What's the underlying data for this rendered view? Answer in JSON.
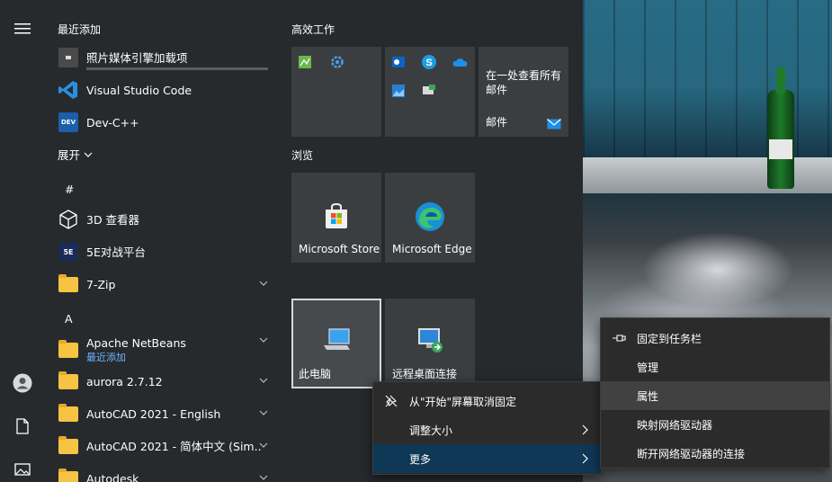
{
  "applist": {
    "recent_header": "最近添加",
    "recent_items": [
      {
        "label": "照片媒体引擎加载项"
      },
      {
        "label": "Visual Studio Code"
      },
      {
        "label": "Dev-C++"
      }
    ],
    "expand_label": "展开",
    "letter_hash": "#",
    "hash_items": [
      {
        "label": "3D 查看器"
      },
      {
        "label": "5E对战平台"
      },
      {
        "label": "7-Zip"
      }
    ],
    "letter_a": "A",
    "a_items": [
      {
        "label": "Apache NetBeans",
        "sub": "最近添加"
      },
      {
        "label": "aurora 2.7.12"
      },
      {
        "label": "AutoCAD 2021 - English"
      },
      {
        "label": "AutoCAD 2021 - 简体中文 (Sim..."
      },
      {
        "label": "Autodesk"
      }
    ]
  },
  "tiles": {
    "group1": "高效工作",
    "mail_text": "在一处查看所有邮件",
    "mail_label": "邮件",
    "group2": "浏览",
    "store_label": "Microsoft Store",
    "edge_label": "Microsoft Edge",
    "pc_label": "此电脑",
    "rdp_label": "远程桌面连接"
  },
  "context_main": {
    "unpin": "从\"开始\"屏幕取消固定",
    "resize": "调整大小",
    "more": "更多"
  },
  "context_sub": {
    "pin_taskbar": "固定到任务栏",
    "manage": "管理",
    "properties": "属性",
    "map_drive": "映射网络驱动器",
    "disconnect_drive": "断开网络驱动器的连接"
  },
  "colors": {
    "accent": "#0f3756",
    "link": "#6fb4ff",
    "menu_bg": "#262a2d",
    "tile_bg": "#3b3e41"
  }
}
